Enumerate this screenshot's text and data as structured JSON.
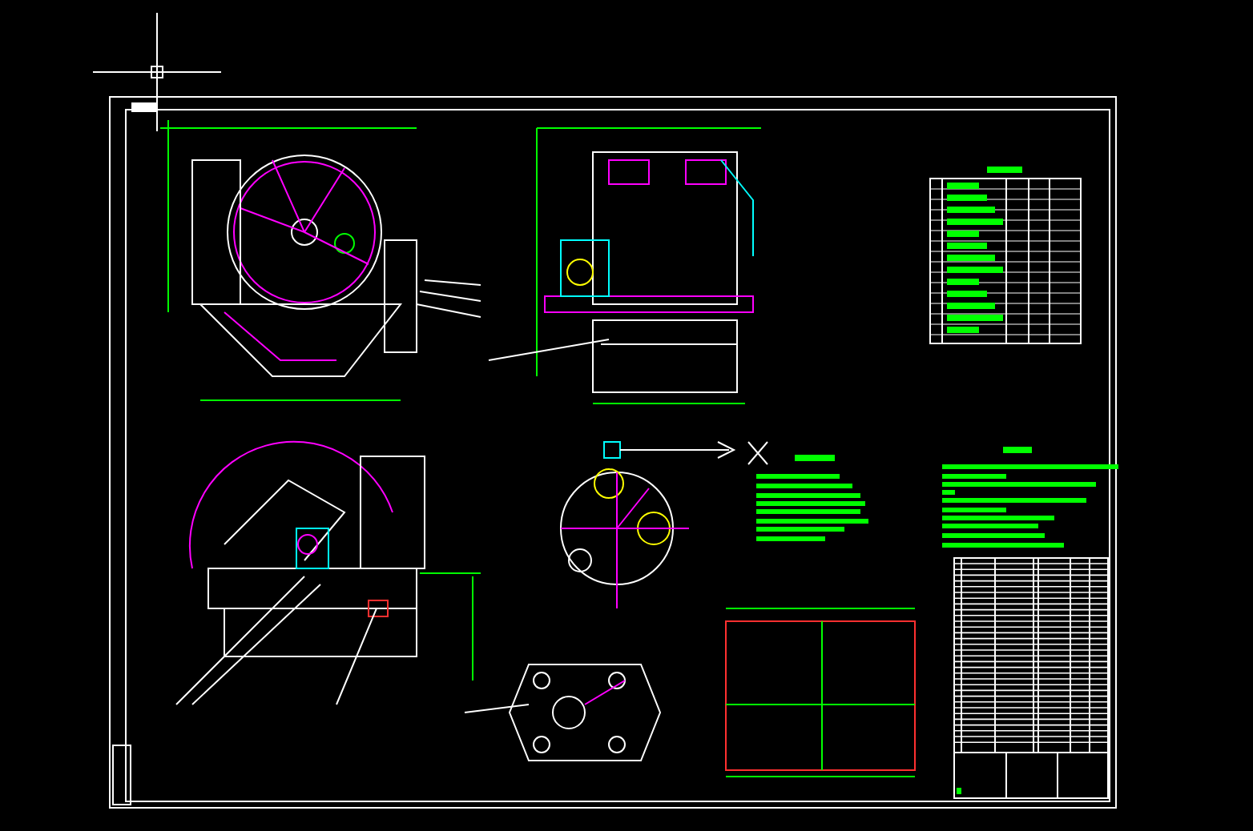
{
  "cad_viewport": {
    "crosshair_cursor": true
  }
}
